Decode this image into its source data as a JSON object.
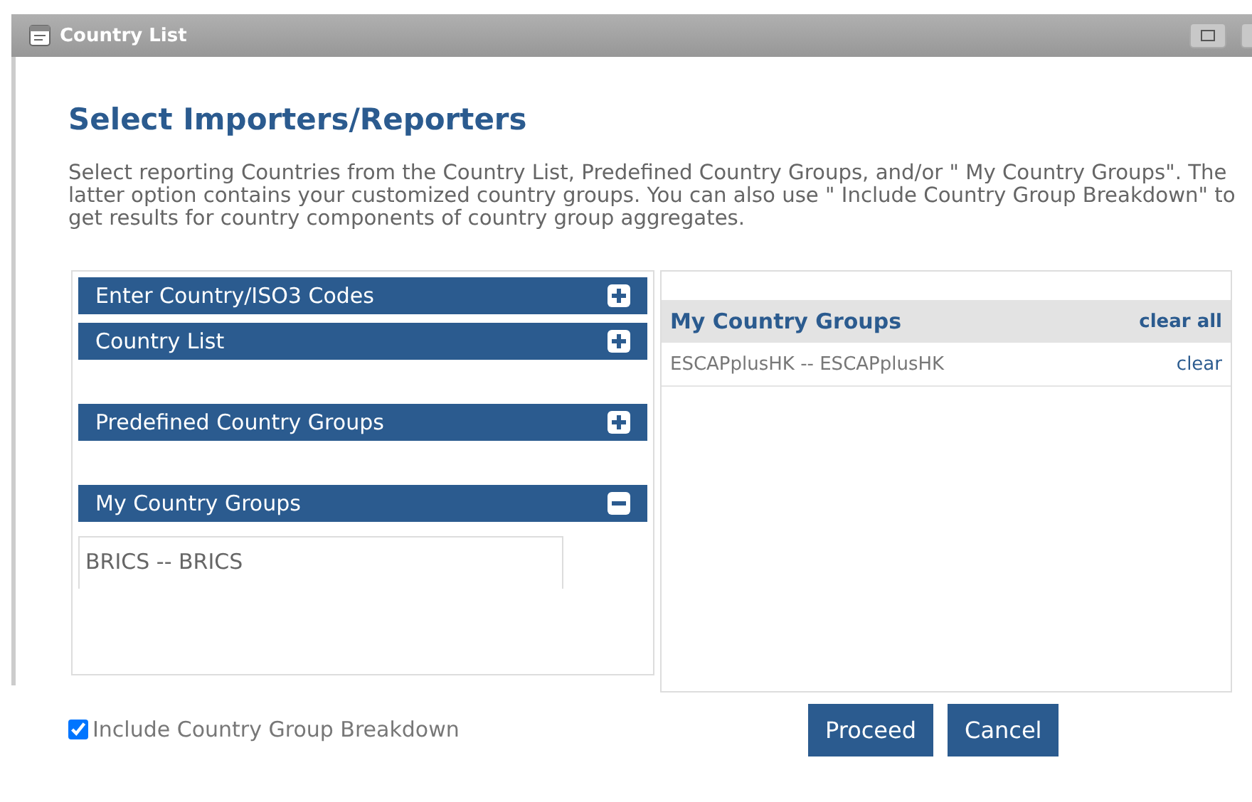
{
  "window": {
    "title": "Country List"
  },
  "heading": "Select Importers/Reporters",
  "intro": "Select reporting Countries from the Country List, Predefined Country Groups, and/or \" My Country Groups\". The latter option contains your customized country groups. You can also use \" Include Country Group Breakdown\" to get results for country components of country group aggregates.",
  "sections": [
    {
      "label": "Enter Country/ISO3 Codes",
      "expanded": false
    },
    {
      "label": "Country List",
      "expanded": false
    },
    {
      "label": "Predefined Country Groups",
      "expanded": false
    },
    {
      "label": "My Country Groups",
      "expanded": true
    }
  ],
  "group_list": [
    "BRICS -- BRICS"
  ],
  "selected_panel": {
    "title": "My Country Groups",
    "clear_all": "clear all",
    "items": [
      {
        "name": "ESCAPplusHK -- ESCAPplusHK",
        "action": "clear"
      }
    ]
  },
  "breakdown": {
    "label": "Include Country Group Breakdown",
    "checked": true
  },
  "buttons": [
    "Proceed",
    "Cancel"
  ]
}
